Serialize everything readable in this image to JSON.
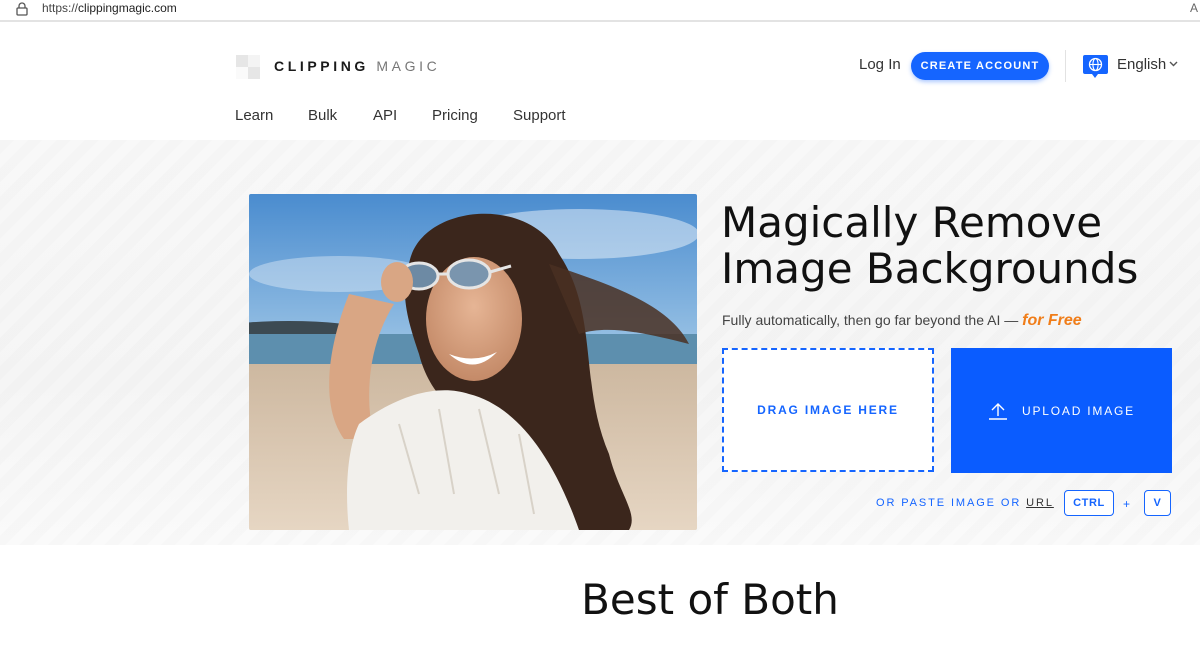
{
  "browser": {
    "url_scheme": "https://",
    "url_host": "clippingmagic.com",
    "right_edge_text": "A"
  },
  "header": {
    "logo_bold": "CLIPPING",
    "logo_light": "MAGIC",
    "login_label": "Log In",
    "create_account_label": "CREATE ACCOUNT",
    "language_label": "English"
  },
  "nav": {
    "items": [
      {
        "label": "Learn"
      },
      {
        "label": "Bulk"
      },
      {
        "label": "API"
      },
      {
        "label": "Pricing"
      },
      {
        "label": "Support"
      }
    ]
  },
  "hero": {
    "headline_line1": "Magically Remove",
    "headline_line2": "Image Backgrounds",
    "subline_text": "Fully automatically, then go far beyond the AI — ",
    "subline_highlight": "for Free",
    "drag_label": "DRAG IMAGE HERE",
    "upload_label": "UPLOAD IMAGE",
    "paste_prefix": "OR PASTE IMAGE OR ",
    "paste_url": "URL",
    "key_ctrl": "CTRL",
    "key_plus": "+",
    "key_v": "V"
  },
  "section": {
    "title": "Best of Both"
  },
  "colors": {
    "accent": "#1565ff",
    "upload": "#0a5cff",
    "free": "#f07d19"
  },
  "icons": [
    "lock-icon",
    "logo-icon",
    "globe-icon",
    "chevron-down-icon",
    "upload-arrow-icon"
  ]
}
